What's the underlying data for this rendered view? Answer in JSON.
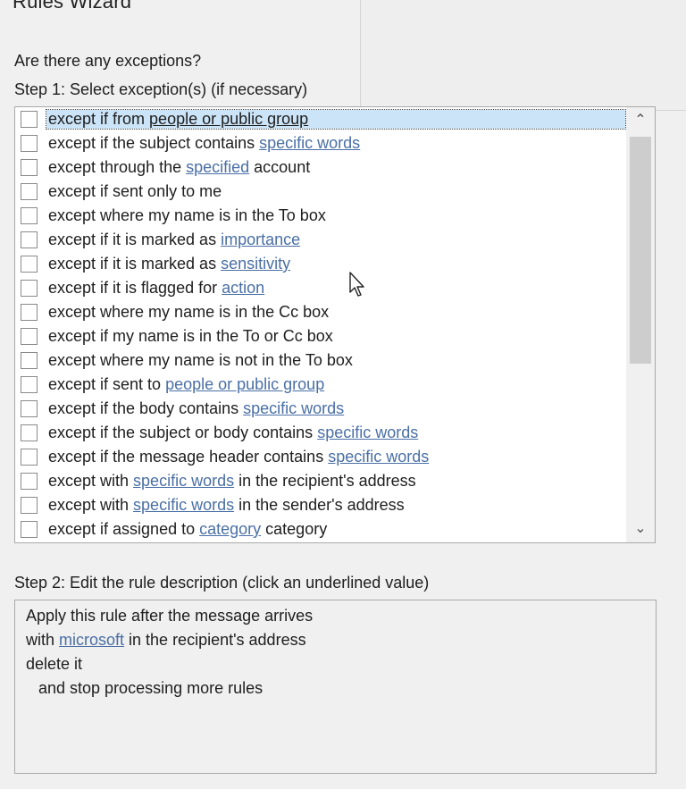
{
  "window": {
    "title": "Rules Wizard"
  },
  "step1": {
    "question": "Are there any exceptions?",
    "label": "Step 1: Select exception(s) (if necessary)"
  },
  "exceptions": [
    {
      "pre": "except if from ",
      "link": "people or public group",
      "post": "",
      "selected": true,
      "checked": false
    },
    {
      "pre": "except if the subject contains ",
      "link": "specific words",
      "post": "",
      "checked": false
    },
    {
      "pre": "except through the ",
      "link": "specified",
      "post": " account",
      "checked": false
    },
    {
      "pre": "except if sent only to me",
      "link": "",
      "post": "",
      "checked": false
    },
    {
      "pre": "except where my name is in the To box",
      "link": "",
      "post": "",
      "checked": false
    },
    {
      "pre": "except if it is marked as ",
      "link": "importance",
      "post": "",
      "checked": false
    },
    {
      "pre": "except if it is marked as ",
      "link": "sensitivity",
      "post": "",
      "checked": false
    },
    {
      "pre": "except if it is flagged for ",
      "link": "action",
      "post": "",
      "checked": false
    },
    {
      "pre": "except where my name is in the Cc box",
      "link": "",
      "post": "",
      "checked": false
    },
    {
      "pre": "except if my name is in the To or Cc box",
      "link": "",
      "post": "",
      "checked": false
    },
    {
      "pre": "except where my name is not in the To box",
      "link": "",
      "post": "",
      "checked": false
    },
    {
      "pre": "except if sent to ",
      "link": "people or public group",
      "post": "",
      "checked": false
    },
    {
      "pre": "except if the body contains ",
      "link": "specific words",
      "post": "",
      "checked": false
    },
    {
      "pre": "except if the subject or body contains ",
      "link": "specific words",
      "post": "",
      "checked": false
    },
    {
      "pre": "except if the message header contains ",
      "link": "specific words",
      "post": "",
      "checked": false
    },
    {
      "pre": "except with ",
      "link": "specific words",
      "post": " in the recipient's address",
      "checked": false
    },
    {
      "pre": "except with ",
      "link": "specific words",
      "post": " in the sender's address",
      "checked": false
    },
    {
      "pre": "except if assigned to ",
      "link": "category",
      "post": " category",
      "checked": false
    }
  ],
  "scrollbar": {
    "up": "^",
    "down": "v"
  },
  "step2": {
    "label": "Step 2: Edit the rule description (click an underlined value)",
    "line1": "Apply this rule after the message arrives",
    "line2_pre": "with ",
    "line2_link": "microsoft",
    "line2_post": " in the recipient's address",
    "line3": "delete it",
    "line4": "and stop processing more rules"
  },
  "colors": {
    "link": "#4a6fa5",
    "selection": "#cce4f7",
    "background": "#f0f0f0"
  }
}
